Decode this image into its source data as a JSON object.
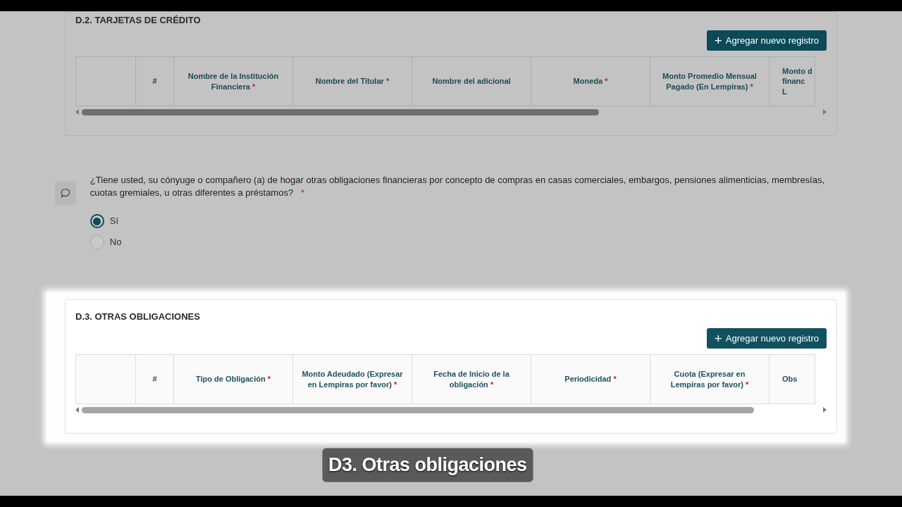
{
  "sections": [
    {
      "title": "D.2. TARJETAS DE CRÉDITO",
      "highlighted": false,
      "button": {
        "icon": "+",
        "label": "Agregar nuevo registro"
      },
      "columns": [
        {},
        {
          "label": "#"
        },
        {
          "label": "Nombre de la Institución Financiera",
          "required_mark": "*"
        },
        {
          "label": "Nombre del Titular",
          "required_mark": "*"
        },
        {
          "label": "Nombre del adicional"
        },
        {
          "label": "Moneda",
          "required_mark": "*"
        },
        {
          "label": "Monto Promedio Mensual Pagado (En Lempiras)",
          "required_mark": "*"
        },
        {
          "label": "Monto d\nfinanc\nL"
        }
      ]
    },
    {
      "question": {
        "text": "¿Tiene usted, su cónyuge o compañero (a) de hogar otras obligaciones financieras por concepto de compras en casas comerciales, embargos, pensiones alimenticias, membresías, cuotas gremiales, u otras diferentes a préstamos?",
        "required_mark": "*",
        "options": [
          {
            "label": "Sí",
            "selected": true
          },
          {
            "label": "No",
            "selected": false
          }
        ]
      }
    },
    {
      "title": "D.3. OTRAS OBLIGACIONES",
      "highlighted": true,
      "button": {
        "icon": "+",
        "label": "Agregar nuevo registro"
      },
      "columns": [
        {},
        {
          "label": "#"
        },
        {
          "label": "Tipo de Obligación",
          "required_mark": "*"
        },
        {
          "label": "Monto Adeudado (Expresar en Lempiras por favor)",
          "required_mark": "*"
        },
        {
          "label": "Fecha de Inicio de la obligación",
          "required_mark": "*"
        },
        {
          "label": "Periodicidad",
          "required_mark": "*"
        },
        {
          "label": "Cuota (Expresar en Lempiras por favor)",
          "required_mark": "*"
        },
        {
          "label": "Obs"
        }
      ]
    }
  ],
  "caption": {
    "text": "D3. Otras obligaciones"
  }
}
